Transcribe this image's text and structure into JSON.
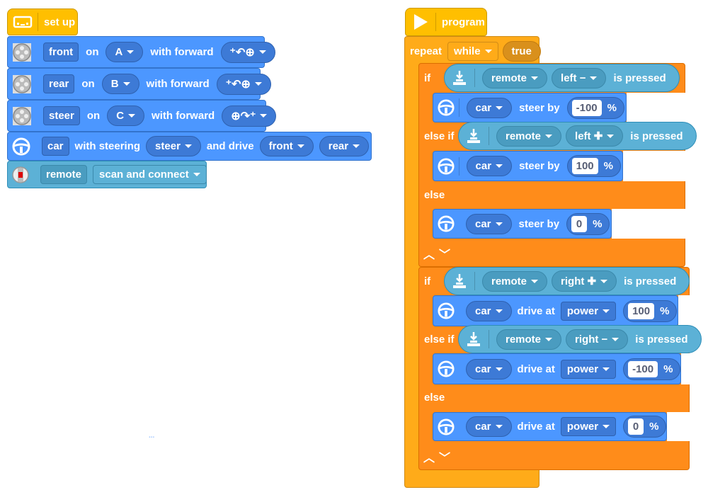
{
  "setup": {
    "hat_label": "set up",
    "motors": [
      {
        "name": "front",
        "on_label": "on",
        "port": "A",
        "with_label": "with forward",
        "direction_icon": "counterclockwise-motor-icon"
      },
      {
        "name": "rear",
        "on_label": "on",
        "port": "B",
        "with_label": "with forward",
        "direction_icon": "counterclockwise-motor-icon"
      },
      {
        "name": "steer",
        "on_label": "on",
        "port": "C",
        "with_label": "with forward",
        "direction_icon": "clockwise-motor-icon"
      }
    ],
    "car": {
      "name": "car",
      "with_steering_label": "with steering",
      "steering": "steer",
      "and_drive_label": "and drive",
      "drive1": "front",
      "drive2": "rear"
    },
    "remote": {
      "name": "remote",
      "action": "scan and connect"
    }
  },
  "program": {
    "hat_label": "program",
    "repeat_label": "repeat",
    "repeat_mode": "while",
    "repeat_condition": "true",
    "if_blocks": [
      {
        "branches": [
          {
            "keyword": "if",
            "device": "remote",
            "button": "left −",
            "suffix": "is pressed",
            "action": {
              "target": "car",
              "verb": "steer by",
              "value": "-100",
              "unit": "%"
            }
          },
          {
            "keyword": "else if",
            "device": "remote",
            "button": "left ✚",
            "suffix": "is pressed",
            "action": {
              "target": "car",
              "verb": "steer by",
              "value": "100",
              "unit": "%"
            }
          }
        ],
        "else_label": "else",
        "else_action": {
          "target": "car",
          "verb": "steer by",
          "value": "0",
          "unit": "%"
        }
      },
      {
        "branches": [
          {
            "keyword": "if",
            "device": "remote",
            "button": "right ✚",
            "suffix": "is pressed",
            "action": {
              "target": "car",
              "verb": "drive at",
              "mode": "power",
              "value": "100",
              "unit": "%"
            }
          },
          {
            "keyword": "else if",
            "device": "remote",
            "button": "right −",
            "suffix": "is pressed",
            "action": {
              "target": "car",
              "verb": "drive at",
              "mode": "power",
              "value": "-100",
              "unit": "%"
            }
          }
        ],
        "else_label": "else",
        "else_action": {
          "target": "car",
          "verb": "drive at",
          "mode": "power",
          "value": "0",
          "unit": "%"
        }
      }
    ]
  },
  "misc": {
    "ellipsis": "..."
  }
}
